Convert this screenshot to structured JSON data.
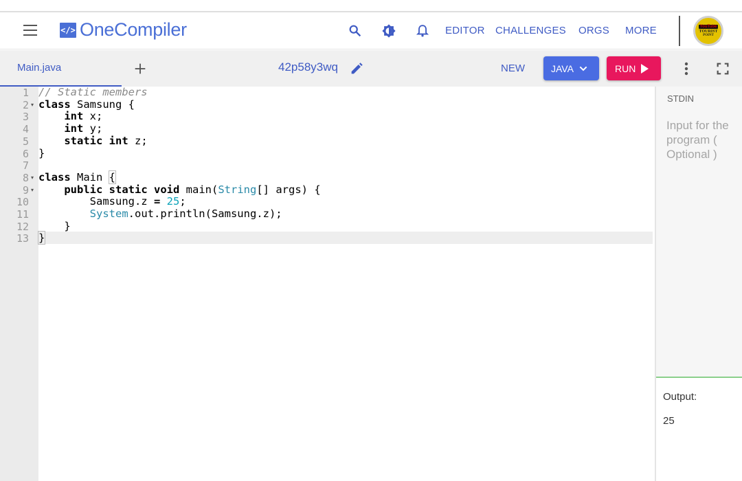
{
  "header": {
    "logo_glyph": "</>",
    "logo_text": "OneCompiler",
    "nav": [
      "EDITOR",
      "CHALLENGES",
      "ORGS",
      "MORE"
    ],
    "avatar_text": [
      "YouTube",
      "TOURIST",
      "POINT"
    ]
  },
  "toolbar": {
    "tab_label": "Main.java",
    "file_name": "42p58y3wq",
    "new_label": "NEW",
    "lang_label": "JAVA",
    "run_label": "RUN"
  },
  "editor": {
    "active_line": 13,
    "line_numbers": [
      "1",
      "2",
      "3",
      "4",
      "5",
      "6",
      "7",
      "8",
      "9",
      "10",
      "11",
      "12",
      "13"
    ],
    "foldable_lines": [
      2,
      8,
      9
    ],
    "lines": [
      [
        [
          "cm",
          "// Static members"
        ]
      ],
      [
        [
          "kw",
          "class"
        ],
        [
          "",
          " Samsung {"
        ]
      ],
      [
        [
          "",
          "    "
        ],
        [
          "kw",
          "int"
        ],
        [
          "",
          " x;"
        ]
      ],
      [
        [
          "",
          "    "
        ],
        [
          "kw",
          "int"
        ],
        [
          "",
          " y;"
        ]
      ],
      [
        [
          "",
          "    "
        ],
        [
          "kw",
          "static"
        ],
        [
          "",
          " "
        ],
        [
          "kw",
          "int"
        ],
        [
          "",
          " z;"
        ]
      ],
      [
        [
          "",
          "}"
        ]
      ],
      [
        [
          "",
          ""
        ]
      ],
      [
        [
          "kw",
          "class"
        ],
        [
          "",
          " Main "
        ],
        [
          "br",
          "{"
        ]
      ],
      [
        [
          "",
          "    "
        ],
        [
          "kw",
          "public"
        ],
        [
          "",
          " "
        ],
        [
          "kw",
          "static"
        ],
        [
          "",
          " "
        ],
        [
          "kw",
          "void"
        ],
        [
          "",
          " main("
        ],
        [
          "ty",
          "String"
        ],
        [
          "",
          "[] args) {"
        ]
      ],
      [
        [
          "",
          "        Samsung.z "
        ],
        [
          "kw",
          "="
        ],
        [
          "",
          " "
        ],
        [
          "nm",
          "25"
        ],
        [
          "",
          ";"
        ]
      ],
      [
        [
          "",
          "        "
        ],
        [
          "ty",
          "System"
        ],
        [
          "",
          ".out.println(Samsung.z);"
        ]
      ],
      [
        [
          "",
          "    }"
        ]
      ],
      [
        [
          "br",
          "}"
        ]
      ]
    ]
  },
  "stdin": {
    "label": "STDIN",
    "placeholder": "Input for the program ( Optional )"
  },
  "output": {
    "label": "Output:",
    "value": "25"
  },
  "colors": {
    "accent": "#3f5bc4",
    "lang_button": "#4a6ce2",
    "run_button": "#e8175d",
    "output_divider": "#8bd08b"
  },
  "icons": [
    "menu-icon",
    "search-icon",
    "theme-icon",
    "bell-icon",
    "plus-icon",
    "pencil-icon",
    "chevron-down-icon",
    "play-icon",
    "more-vert-icon",
    "fullscreen-icon"
  ]
}
